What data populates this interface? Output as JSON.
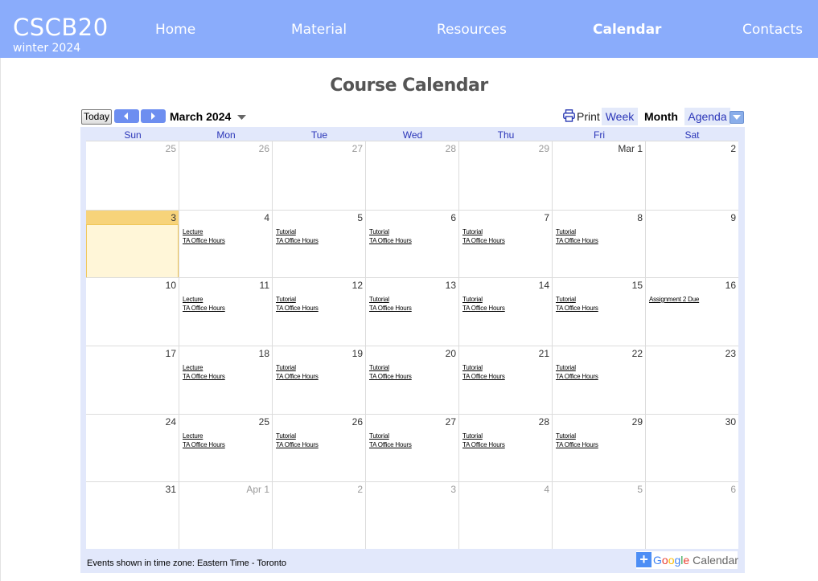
{
  "header": {
    "brand": "CSCB20",
    "subtitle": "winter 2024",
    "nav": [
      {
        "label": "Home",
        "active": false
      },
      {
        "label": "Material",
        "active": false
      },
      {
        "label": "Resources",
        "active": false
      },
      {
        "label": "Calendar",
        "active": true
      },
      {
        "label": "Contacts",
        "active": false
      }
    ]
  },
  "page": {
    "title": "Course Calendar"
  },
  "calendar": {
    "today_label": "Today",
    "month_label": "March 2024",
    "print_label": "Print",
    "views": [
      {
        "label": "Week",
        "selected": false
      },
      {
        "label": "Month",
        "selected": true
      },
      {
        "label": "Agenda",
        "selected": false
      }
    ],
    "weekdays": [
      "Sun",
      "Mon",
      "Tue",
      "Wed",
      "Thu",
      "Fri",
      "Sat"
    ],
    "today": "3",
    "weeks": [
      [
        {
          "day": "25",
          "other": true,
          "events": []
        },
        {
          "day": "26",
          "other": true,
          "events": []
        },
        {
          "day": "27",
          "other": true,
          "events": []
        },
        {
          "day": "28",
          "other": true,
          "events": []
        },
        {
          "day": "29",
          "other": true,
          "events": []
        },
        {
          "day": "Mar 1",
          "other": false,
          "events": []
        },
        {
          "day": "2",
          "other": false,
          "events": []
        }
      ],
      [
        {
          "day": "3",
          "other": false,
          "today": true,
          "events": []
        },
        {
          "day": "4",
          "other": false,
          "events": [
            "Lecture",
            "TA Office Hours"
          ]
        },
        {
          "day": "5",
          "other": false,
          "events": [
            "Tutorial",
            "TA Office Hours"
          ]
        },
        {
          "day": "6",
          "other": false,
          "events": [
            "Tutorial",
            "TA Office Hours"
          ]
        },
        {
          "day": "7",
          "other": false,
          "events": [
            "Tutorial",
            "TA Office Hours"
          ]
        },
        {
          "day": "8",
          "other": false,
          "events": [
            "Tutorial",
            "TA Office Hours"
          ]
        },
        {
          "day": "9",
          "other": false,
          "events": []
        }
      ],
      [
        {
          "day": "10",
          "other": false,
          "events": []
        },
        {
          "day": "11",
          "other": false,
          "events": [
            "Lecture",
            "TA Office Hours"
          ]
        },
        {
          "day": "12",
          "other": false,
          "events": [
            "Tutorial",
            "TA Office Hours"
          ]
        },
        {
          "day": "13",
          "other": false,
          "events": [
            "Tutorial",
            "TA Office Hours"
          ]
        },
        {
          "day": "14",
          "other": false,
          "events": [
            "Tutorial",
            "TA Office Hours"
          ]
        },
        {
          "day": "15",
          "other": false,
          "events": [
            "Tutorial",
            "TA Office Hours"
          ]
        },
        {
          "day": "16",
          "other": false,
          "events": [
            "Assignment 2 Due"
          ]
        }
      ],
      [
        {
          "day": "17",
          "other": false,
          "events": []
        },
        {
          "day": "18",
          "other": false,
          "events": [
            "Lecture",
            "TA Office Hours"
          ]
        },
        {
          "day": "19",
          "other": false,
          "events": [
            "Tutorial",
            "TA Office Hours"
          ]
        },
        {
          "day": "20",
          "other": false,
          "events": [
            "Tutorial",
            "TA Office Hours"
          ]
        },
        {
          "day": "21",
          "other": false,
          "events": [
            "Tutorial",
            "TA Office Hours"
          ]
        },
        {
          "day": "22",
          "other": false,
          "events": [
            "Tutorial",
            "TA Office Hours"
          ]
        },
        {
          "day": "23",
          "other": false,
          "events": []
        }
      ],
      [
        {
          "day": "24",
          "other": false,
          "events": []
        },
        {
          "day": "25",
          "other": false,
          "events": [
            "Lecture",
            "TA Office Hours"
          ]
        },
        {
          "day": "26",
          "other": false,
          "events": [
            "Tutorial",
            "TA Office Hours"
          ]
        },
        {
          "day": "27",
          "other": false,
          "events": [
            "Tutorial",
            "TA Office Hours"
          ]
        },
        {
          "day": "28",
          "other": false,
          "events": [
            "Tutorial",
            "TA Office Hours"
          ]
        },
        {
          "day": "29",
          "other": false,
          "events": [
            "Tutorial",
            "TA Office Hours"
          ]
        },
        {
          "day": "30",
          "other": false,
          "events": []
        }
      ],
      [
        {
          "day": "31",
          "other": false,
          "events": []
        },
        {
          "day": "Apr 1",
          "other": true,
          "events": []
        },
        {
          "day": "2",
          "other": true,
          "events": []
        },
        {
          "day": "3",
          "other": true,
          "events": []
        },
        {
          "day": "4",
          "other": true,
          "events": []
        },
        {
          "day": "5",
          "other": true,
          "events": []
        },
        {
          "day": "6",
          "other": true,
          "events": []
        }
      ]
    ],
    "timezone_note": "Events shown in time zone: Eastern Time - Toronto",
    "gcal_button": {
      "prefix": "+",
      "google": "Google",
      "word": "Calendar"
    },
    "icons": {
      "prev": "chevron-left-icon",
      "next": "chevron-right-icon",
      "print": "printer-icon",
      "caret": "chevron-down-icon"
    },
    "colors": {
      "header_bg": "#8aacfb",
      "today_bg": "#fff6d8",
      "today_head": "#f7d37a",
      "nav_button": "#6d8ef0"
    }
  }
}
